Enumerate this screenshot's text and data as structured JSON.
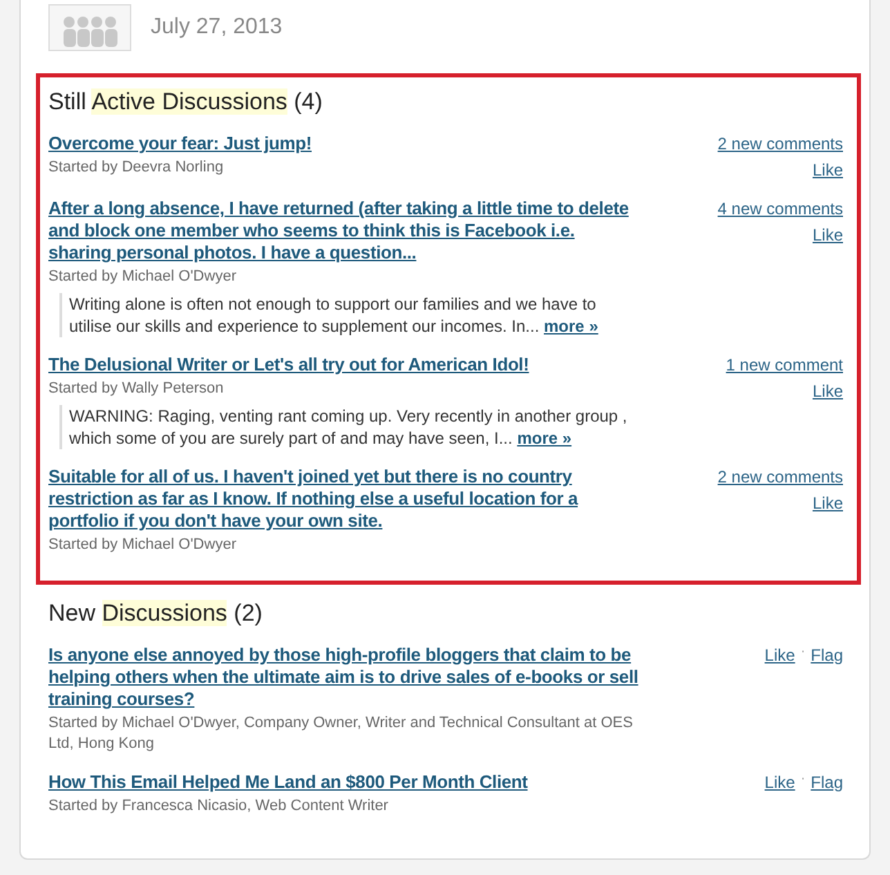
{
  "header": {
    "date": "July 27, 2013"
  },
  "sections": [
    {
      "highlighted": true,
      "title_parts": [
        {
          "text": "Still ",
          "highlighted": false
        },
        {
          "text": "Active Discussions",
          "highlighted": true
        }
      ],
      "count": "(4)",
      "items": [
        {
          "title": "Overcome your fear: Just jump!",
          "started_by": "Started by Deevra Norling",
          "actions": [
            {
              "kind": "comments",
              "label": "2 new comments"
            },
            {
              "kind": "like",
              "label": "Like"
            }
          ]
        },
        {
          "title": "After a long absence, I have returned (after taking a little time to delete and block one member who seems to think this is Facebook i.e. sharing personal photos. I have a question...",
          "started_by": "Started by Michael O'Dwyer",
          "excerpt": "Writing alone is often not enough to support our families and we have to utilise our skills and experience to supplement our incomes. In...",
          "more": "more »",
          "actions": [
            {
              "kind": "comments",
              "label": "4 new comments"
            },
            {
              "kind": "like",
              "label": "Like"
            }
          ]
        },
        {
          "title": "The Delusional Writer or Let's all try out for American Idol!",
          "started_by": "Started by Wally Peterson",
          "excerpt": "WARNING: Raging, venting rant coming up. Very recently in another group , which some of you are surely part of and may have seen, I...",
          "more": "more »",
          "actions": [
            {
              "kind": "comments",
              "label": "1 new comment"
            },
            {
              "kind": "like",
              "label": "Like"
            }
          ]
        },
        {
          "title": "Suitable for all of us. I haven't joined yet but there is no country restriction as far as I know. If nothing else a useful location for a portfolio if you don't have your own site.",
          "started_by": "Started by Michael O'Dwyer",
          "actions": [
            {
              "kind": "comments",
              "label": "2 new comments"
            },
            {
              "kind": "like",
              "label": "Like"
            }
          ]
        }
      ]
    },
    {
      "highlighted": false,
      "title_parts": [
        {
          "text": "New ",
          "highlighted": false
        },
        {
          "text": "Discussions",
          "highlighted": true
        }
      ],
      "count": "(2)",
      "items": [
        {
          "title": "Is anyone else annoyed by those high-profile bloggers that claim to be helping others when the ultimate aim is to drive sales of e-books or sell training courses?",
          "started_by": "Started by Michael O'Dwyer, Company Owner, Writer and Technical Consultant at OES Ltd, Hong Kong",
          "separator": "·",
          "actions": [
            {
              "kind": "inline",
              "label": "Like"
            },
            {
              "kind": "inline",
              "label": "Flag"
            }
          ]
        },
        {
          "title": "How This Email Helped Me Land an $800 Per Month Client",
          "started_by": "Started by Francesca Nicasio, Web Content Writer",
          "separator": "·",
          "actions": [
            {
              "kind": "inline",
              "label": "Like"
            },
            {
              "kind": "inline",
              "label": "Flag"
            }
          ]
        }
      ]
    }
  ]
}
